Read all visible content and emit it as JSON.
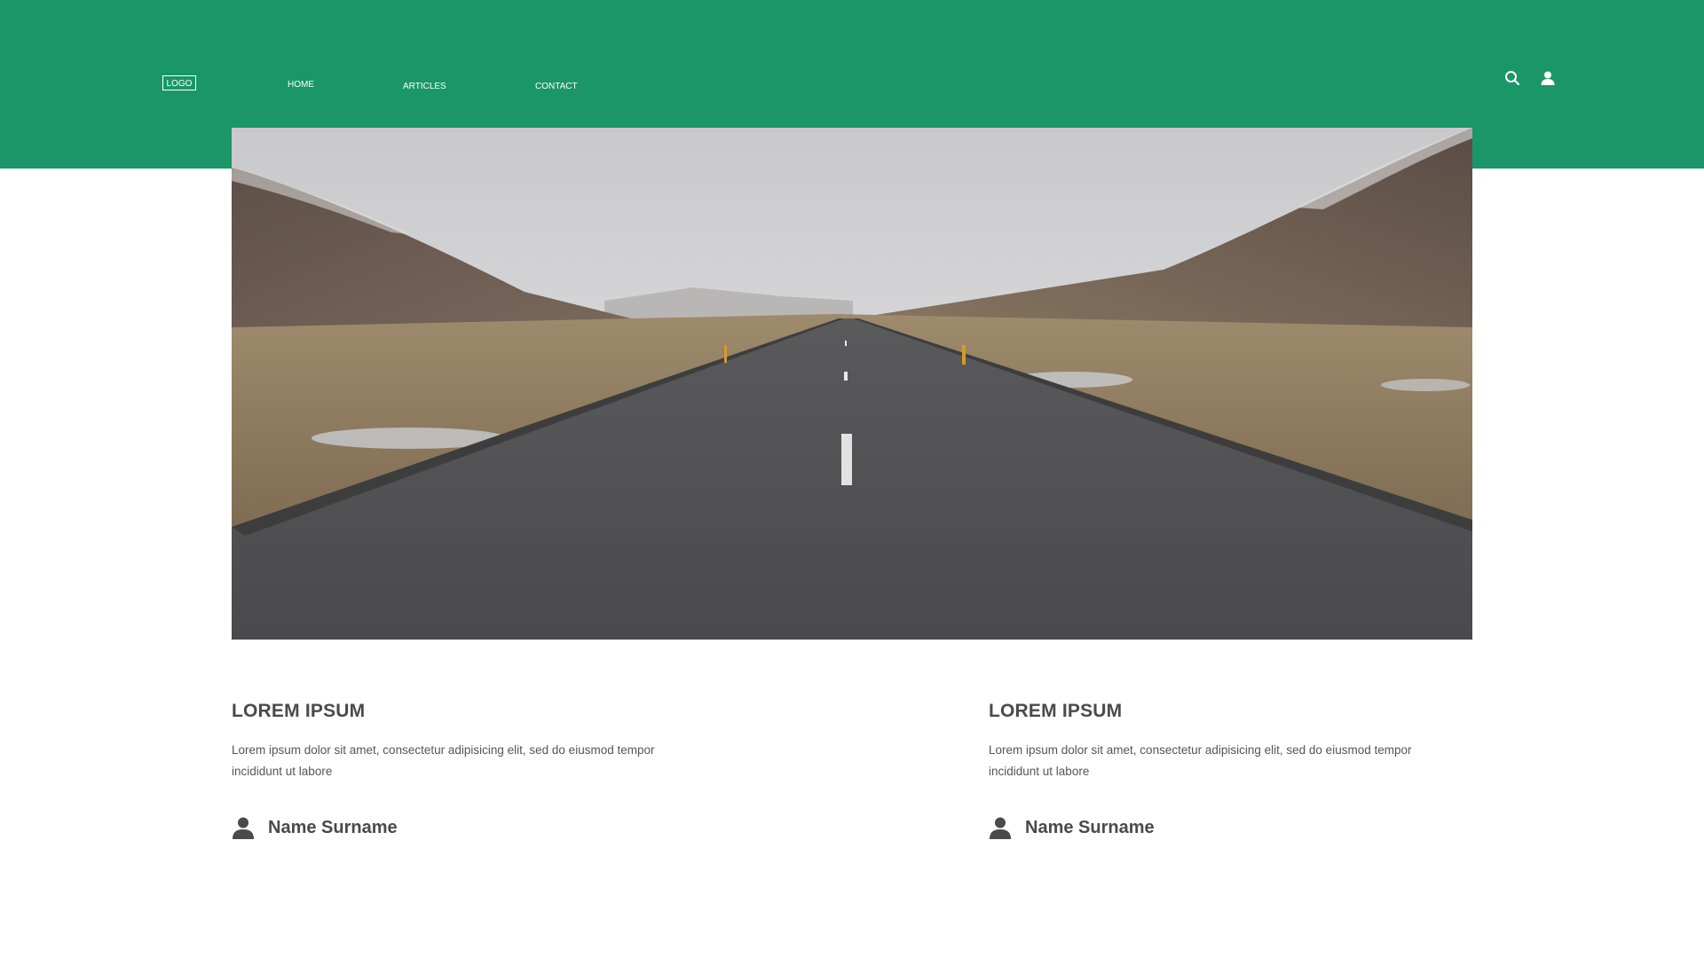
{
  "header": {
    "logo": "LOGO",
    "nav": [
      {
        "label": "HOME"
      },
      {
        "label": "ARTICLES"
      },
      {
        "label": "CONTACT"
      }
    ],
    "icons": [
      "search-icon",
      "user-icon"
    ],
    "background_color": "#1a9669"
  },
  "hero": {
    "image": "road-through-mountain-valley"
  },
  "cards": [
    {
      "title": "LOREM IPSUM",
      "text": "Lorem ipsum dolor sit amet, consectetur adipisicing elit, sed do eiusmod tempor incididunt ut labore",
      "author": "Name Surname"
    },
    {
      "title": "LOREM IPSUM",
      "text": "Lorem ipsum dolor sit amet, consectetur adipisicing elit, sed do eiusmod tempor incididunt ut labore",
      "author": "Name Surname"
    }
  ]
}
